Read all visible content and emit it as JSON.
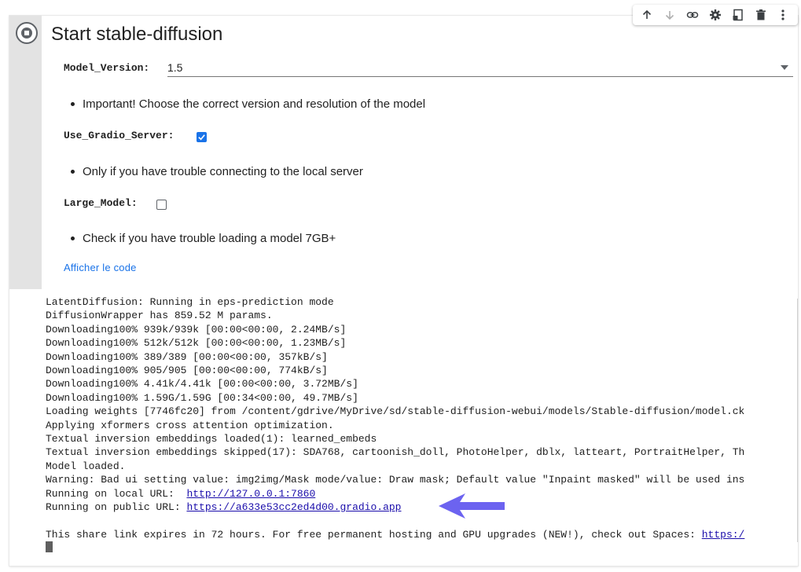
{
  "cell": {
    "title": "Start stable-diffusion",
    "toolbar_icons": [
      "arrow-up-icon",
      "arrow-down-icon",
      "link-icon",
      "gear-icon",
      "mirror-cell-icon",
      "trash-icon",
      "more-vert-icon"
    ]
  },
  "form": {
    "model_version_label": "Model_Version:",
    "model_version_value": "1.5",
    "note_model": "Important! Choose the correct version and resolution of the model",
    "use_gradio_label": "Use_Gradio_Server:",
    "use_gradio_checked": true,
    "note_gradio": "Only if you have trouble connecting to the local server",
    "large_model_label": "Large_Model:",
    "large_model_checked": false,
    "note_large": "Check if you have trouble loading a model 7GB+",
    "show_code": "Afficher le code"
  },
  "output": {
    "lines": [
      "LatentDiffusion: Running in eps-prediction mode",
      "DiffusionWrapper has 859.52 M params.",
      "Downloading100% 939k/939k [00:00<00:00, 2.24MB/s]",
      "Downloading100% 512k/512k [00:00<00:00, 1.23MB/s]",
      "Downloading100% 389/389 [00:00<00:00, 357kB/s]",
      "Downloading100% 905/905 [00:00<00:00, 774kB/s]",
      "Downloading100% 4.41k/4.41k [00:00<00:00, 3.72MB/s]",
      "Downloading100% 1.59G/1.59G [00:34<00:00, 49.7MB/s]",
      "Loading weights [7746fc20] from /content/gdrive/MyDrive/sd/stable-diffusion-webui/models/Stable-diffusion/model.ck",
      "Applying xformers cross attention optimization.",
      "Textual inversion embeddings loaded(1): learned_embeds",
      "Textual inversion embeddings skipped(17): SDA768, cartoonish_doll, PhotoHelper, dblx, latteart, PortraitHelper, Th",
      "Model loaded.",
      "Warning: Bad ui setting value: img2img/Mask mode/value: Draw mask; Default value \"Inpaint masked\" will be used ins"
    ],
    "local_url_label": "Running on local URL:  ",
    "local_url": "http://127.0.0.1:7860",
    "public_url_label": "Running on public URL: ",
    "public_url": "https://a633e53cc2ed4d00.gradio.app",
    "share_text": "This share link expires in 72 hours. For free permanent hosting and GPU upgrades (NEW!), check out Spaces: ",
    "share_link": "https:/"
  },
  "colors": {
    "accent": "#1a73e8",
    "arrow": "#6c63f0",
    "gutter": "#e3e3e3"
  }
}
